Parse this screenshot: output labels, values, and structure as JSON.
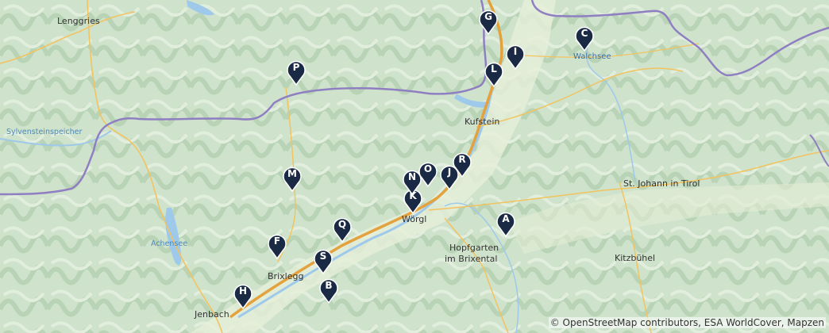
{
  "map": {
    "places": {
      "lenggries": "Lenggries",
      "sylvenstein": "Sylvensteinspeicher",
      "achensee": "Achensee",
      "kufstein": "Kufstein",
      "woergl": "Wörgl",
      "brixlegg": "Brixlegg",
      "jenbach": "Jenbach",
      "hopfgarten_1": "Hopfgarten",
      "hopfgarten_2": "im Brixental",
      "walchsee": "Walchsee",
      "st_johann": "St. Johann in Tirol",
      "kitzbuehel": "Kitzbühel"
    },
    "markers": [
      "A",
      "B",
      "C",
      "F",
      "G",
      "H",
      "I",
      "J",
      "K",
      "L",
      "M",
      "N",
      "O",
      "P",
      "Q",
      "R",
      "S"
    ],
    "attribution": "© OpenStreetMap contributors, ESA WorldCover, Mapzen",
    "colors": {
      "marker": "#1b2a44",
      "border": "#8f7fc2",
      "road": "#f2c35f",
      "motorway": "#e3a23e",
      "water": "#9ec9ea",
      "land": "#cfe3cc"
    }
  }
}
